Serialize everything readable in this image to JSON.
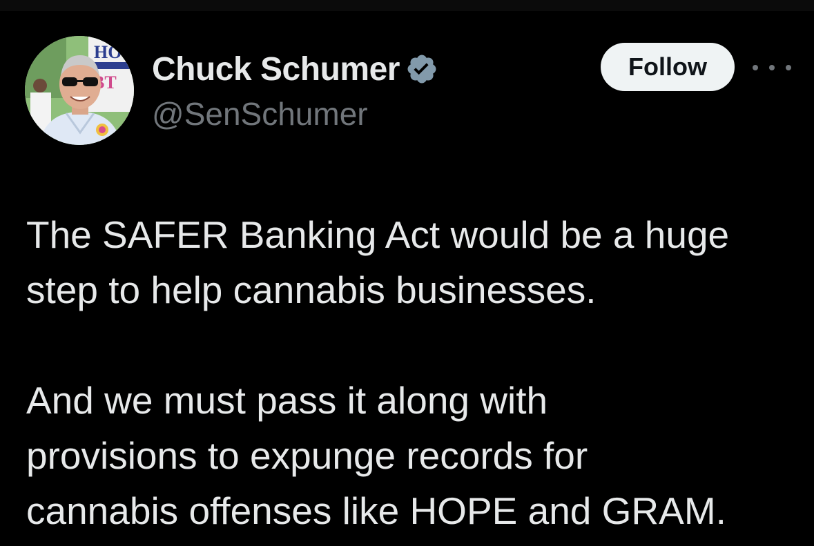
{
  "author": {
    "display_name": "Chuck Schumer",
    "handle": "@SenSchumer",
    "verified_icon": "verified-badge-icon",
    "avatar_icon": "profile-photo",
    "avatar_sign_text": "HO BT"
  },
  "actions": {
    "follow_label": "Follow",
    "more_icon": "more-options-icon"
  },
  "tweet": {
    "lines": [
      "The SAFER Banking Act would be a huge",
      "step to help cannabis businesses.",
      "And we must pass it along with",
      "provisions to expunge records for",
      "cannabis offenses like HOPE and GRAM."
    ]
  },
  "colors": {
    "background": "#000000",
    "text_primary": "#e7e9ea",
    "text_secondary": "#71767b",
    "follow_bg": "#eff3f4",
    "verified": "#829aab"
  }
}
